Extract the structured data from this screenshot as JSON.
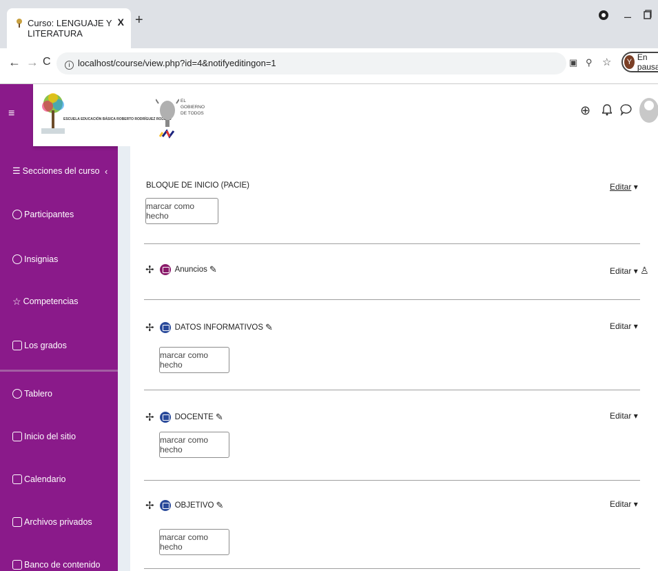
{
  "browser": {
    "tab_title": "Curso: LENGUAJE Y LITERATURA",
    "tab_close": "X",
    "new_tab": "+",
    "url": "localhost/course/view.php?id=4&notifyeditingon=1",
    "profile_initial": "Y",
    "profile_status": "En pausa"
  },
  "header": {
    "school_name": "ESCUELA EDUCACIÓN BÁSICA ROBERTO RODRÍGUEZ RODERO",
    "gov_line1": "EL",
    "gov_line2": "GOBIERNO",
    "gov_line3": "DE TODOS"
  },
  "sidebar": {
    "menu_icon": "≡",
    "items": [
      {
        "label": "Secciones del curso",
        "icon": "list-icon"
      },
      {
        "label": "Participantes",
        "icon": "users-icon"
      },
      {
        "label": "Insignias",
        "icon": "badge-icon"
      },
      {
        "label": "Competencias",
        "icon": "star-icon"
      },
      {
        "label": "Los grados",
        "icon": "table-icon"
      },
      {
        "label": "Tablero",
        "icon": "dashboard-icon"
      },
      {
        "label": "Inicio del sitio",
        "icon": "home-icon"
      },
      {
        "label": "Calendario",
        "icon": "calendar-icon"
      },
      {
        "label": "Archivos privados",
        "icon": "file-icon"
      },
      {
        "label": "Banco de contenido",
        "icon": "content-bank-icon"
      }
    ]
  },
  "content": {
    "section0_title": "BLOQUE DE INICIO (PACIE)",
    "mark_label": "marcar como hecho",
    "edit_label": "Editar",
    "activities": [
      {
        "name": "Anuncios",
        "icon": "forum-icon"
      },
      {
        "name": "DATOS INFORMATIVOS",
        "icon": "page-icon"
      },
      {
        "name": "DOCENTE",
        "icon": "page-icon"
      },
      {
        "name": "OBJETIVO",
        "icon": "page-icon"
      }
    ]
  },
  "colors": {
    "sidebar": "#8a1a8a",
    "activity_icon": "#2a4a9a"
  }
}
